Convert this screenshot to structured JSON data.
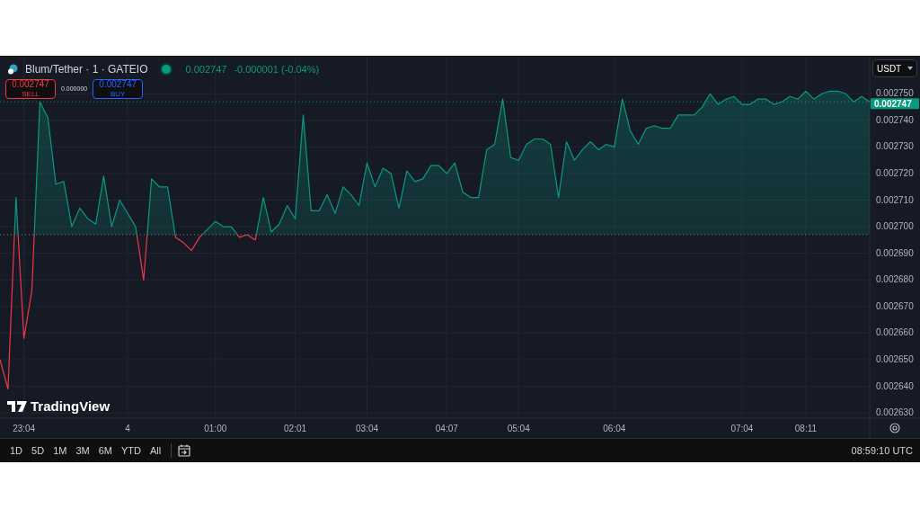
{
  "header": {
    "symbol": "Blum/Tether · 1 · GATEIO",
    "last": "0.002747",
    "change": "-0.000001 (-0.04%)"
  },
  "trade": {
    "sell_price": "0.002747",
    "sell_label": "SELL",
    "spread": "0.000000",
    "buy_price": "0.002747",
    "buy_label": "BUY"
  },
  "currency": "USDT",
  "price_tag": "0.002747",
  "logo": "TradingView",
  "chart_data": {
    "type": "area",
    "grid": true,
    "categories": [
      null,
      null,
      null,
      "23:04",
      null,
      null,
      null,
      null,
      null,
      null,
      null,
      null,
      null,
      null,
      null,
      null,
      "4",
      null,
      null,
      null,
      null,
      null,
      null,
      null,
      null,
      null,
      null,
      "01:00",
      null,
      null,
      null,
      null,
      null,
      null,
      null,
      null,
      null,
      "02:01",
      null,
      null,
      null,
      null,
      null,
      null,
      null,
      null,
      "03:04",
      null,
      null,
      null,
      null,
      null,
      null,
      null,
      null,
      null,
      "04:07",
      null,
      null,
      null,
      null,
      null,
      null,
      null,
      null,
      "05:04",
      null,
      null,
      null,
      null,
      null,
      null,
      null,
      null,
      null,
      null,
      null,
      "06:04",
      null,
      null,
      null,
      null,
      null,
      null,
      null,
      null,
      null,
      null,
      null,
      null,
      null,
      null,
      null,
      "07:04",
      null,
      null,
      null,
      null,
      null,
      null,
      null,
      "08:11",
      null,
      null,
      null,
      null,
      null,
      null,
      null,
      null
    ],
    "series": [
      {
        "color": "#089981",
        "values": [
          0.00265,
          0.002639,
          0.002711,
          0.002658,
          0.002676,
          0.002747,
          0.002741,
          0.002716,
          0.002717,
          0.0027,
          0.002707,
          0.002703,
          0.002701,
          0.002719,
          0.0027,
          0.00271,
          0.002705,
          0.0027,
          0.00268,
          0.002718,
          0.002715,
          0.002715,
          0.002696,
          0.002694,
          0.002691,
          0.002696,
          0.002699,
          0.002702,
          0.0027,
          0.0027,
          0.002696,
          0.002697,
          0.002695,
          0.002711,
          0.002698,
          0.002701,
          0.002708,
          0.002703,
          0.002742,
          0.002706,
          0.002706,
          0.002712,
          0.002705,
          0.002715,
          0.002712,
          0.002708,
          0.002724,
          0.002715,
          0.002722,
          0.00272,
          0.002707,
          0.002721,
          0.002717,
          0.002718,
          0.002723,
          0.002723,
          0.00272,
          0.002724,
          0.002713,
          0.002711,
          0.002711,
          0.002729,
          0.002731,
          0.002748,
          0.002726,
          0.002725,
          0.002731,
          0.002733,
          0.002733,
          0.002731,
          0.002711,
          0.002732,
          0.002725,
          0.002729,
          0.002732,
          0.002729,
          0.002731,
          0.00273,
          0.002748,
          0.002736,
          0.002731,
          0.002737,
          0.002738,
          0.002737,
          0.002737,
          0.002742,
          0.002742,
          0.002742,
          0.002745,
          0.00275,
          0.002746,
          0.002748,
          0.002749,
          0.002746,
          0.002746,
          0.002748,
          0.002748,
          0.002746,
          0.002747,
          0.002749,
          0.002748,
          0.002751,
          0.002748,
          0.00275,
          0.002751,
          0.002751,
          0.00275,
          0.002747,
          0.002749,
          0.002747
        ]
      }
    ],
    "ylim": [
      0.002628,
      0.0027643
    ],
    "yticks": [
      {
        "value": 0.00263,
        "label": "0.002630"
      },
      {
        "value": 0.00264,
        "label": "0.002640"
      },
      {
        "value": 0.00265,
        "label": "0.002650"
      },
      {
        "value": 0.00266,
        "label": "0.002660"
      },
      {
        "value": 0.00267,
        "label": "0.002670"
      },
      {
        "value": 0.00268,
        "label": "0.002680"
      },
      {
        "value": 0.00269,
        "label": "0.002690"
      },
      {
        "value": 0.0027,
        "label": "0.002700"
      },
      {
        "value": 0.00271,
        "label": "0.002710"
      },
      {
        "value": 0.00272,
        "label": "0.002720"
      },
      {
        "value": 0.00273,
        "label": "0.002730"
      },
      {
        "value": 0.00274,
        "label": "0.002740"
      },
      {
        "value": 0.00275,
        "label": "0.002750"
      }
    ],
    "ref_lines": [
      {
        "axis": "y",
        "value": 0.002697
      },
      {
        "axis": "y",
        "value": 0.002747
      }
    ]
  },
  "ranges": [
    "1D",
    "5D",
    "1M",
    "3M",
    "6M",
    "YTD",
    "All"
  ],
  "clock": "08:59:10 UTC"
}
